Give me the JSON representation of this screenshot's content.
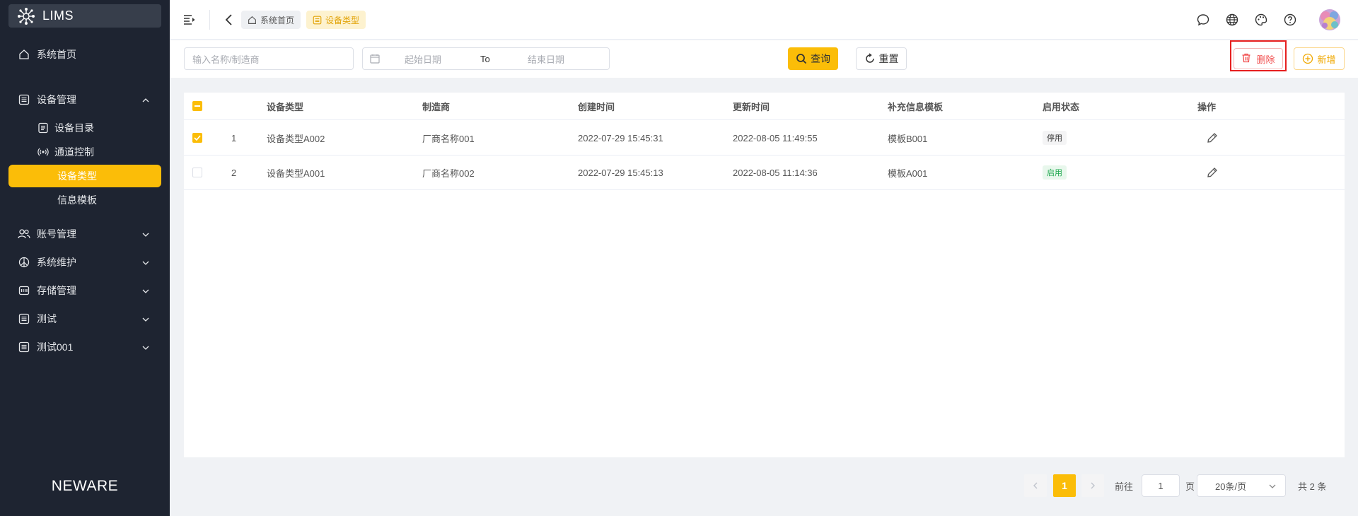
{
  "app": {
    "logo_text": "LIMS",
    "footer_brand": "NEWARE"
  },
  "sidebar": {
    "home": "系统首页",
    "device_mgmt": "设备管理",
    "sub": [
      "设备目录",
      "通道控制",
      "设备类型",
      "信息模板"
    ],
    "account_mgmt": "账号管理",
    "system_maint": "系统维护",
    "storage_mgmt": "存储管理",
    "test": "测试",
    "test001": "测试001"
  },
  "breadcrumb": {
    "home": "系统首页",
    "current": "设备类型"
  },
  "filter": {
    "name_placeholder": "输入名称/制造商",
    "start_placeholder": "起始日期",
    "range_sep": "To",
    "end_placeholder": "结束日期",
    "query_label": "查询",
    "reset_label": "重置",
    "delete_label": "删除",
    "add_label": "新增"
  },
  "table": {
    "headers": [
      "设备类型",
      "制造商",
      "创建时间",
      "更新时间",
      "补充信息模板",
      "启用状态",
      "操作"
    ],
    "rows": [
      {
        "index": "1",
        "type": "设备类型A002",
        "maker": "厂商名称001",
        "created": "2022-07-29 15:45:31",
        "updated": "2022-08-05 11:49:55",
        "template": "模板B001",
        "status": "停用",
        "checked": true
      },
      {
        "index": "2",
        "type": "设备类型A001",
        "maker": "厂商名称002",
        "created": "2022-07-29 15:45:13",
        "updated": "2022-08-05 11:14:36",
        "template": "模板A001",
        "status": "启用",
        "checked": false
      }
    ]
  },
  "pagination": {
    "current": "1",
    "goto_label": "前往",
    "goto_value": "1",
    "page_unit": "页",
    "page_size": "20条/页",
    "total": "共 2 条"
  },
  "colors": {
    "accent": "#fbbd08",
    "sidebar_bg": "#1e2431",
    "danger": "#f14b4b",
    "success": "#1fa84f"
  }
}
